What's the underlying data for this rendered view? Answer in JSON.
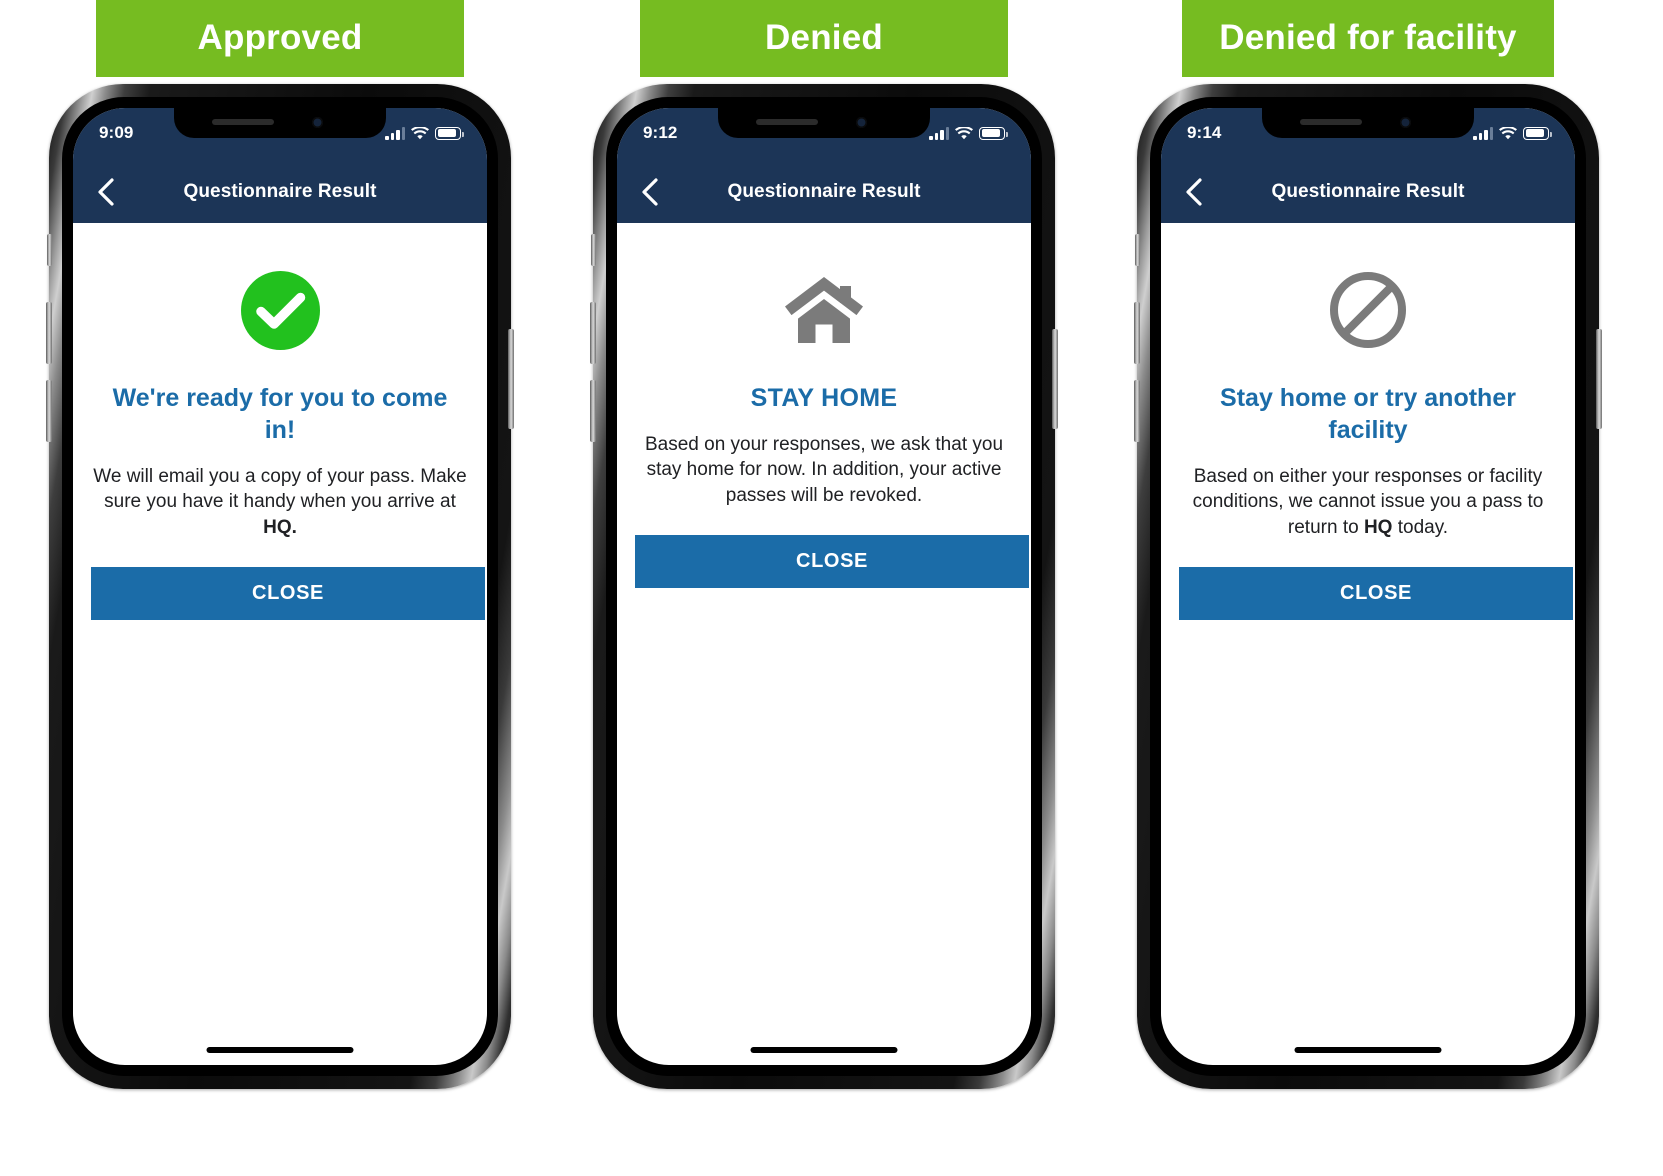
{
  "colors": {
    "banner_green": "#76bc21",
    "navbar_navy": "#1c3557",
    "accent_blue": "#1b6ca8",
    "success_green": "#22c11e",
    "icon_gray": "#7b7b7b"
  },
  "panels": [
    {
      "banner_label": "Approved",
      "status": {
        "time": "9:09",
        "signal_icon": "cellular-signal-icon",
        "wifi_icon": "wifi-icon",
        "battery_icon": "battery-icon"
      },
      "nav": {
        "back_icon": "back-chevron-icon",
        "title": "Questionnaire Result"
      },
      "result_icon": "green-check-circle-icon",
      "title": "We're ready for you to come in!",
      "body_lead": "We will email you a copy of your pass. Make sure you have it handy when you arrive at ",
      "body_bold": "HQ.",
      "body_tail": "",
      "close_label": "CLOSE"
    },
    {
      "banner_label": "Denied",
      "status": {
        "time": "9:12",
        "signal_icon": "cellular-signal-icon",
        "wifi_icon": "wifi-icon",
        "battery_icon": "battery-icon"
      },
      "nav": {
        "back_icon": "back-chevron-icon",
        "title": "Questionnaire Result"
      },
      "result_icon": "house-icon",
      "title": "STAY HOME",
      "body_lead": "Based on your responses, we ask that you stay home for now. In addition, your active passes will be revoked.",
      "body_bold": "",
      "body_tail": "",
      "close_label": "CLOSE"
    },
    {
      "banner_label": "Denied for facility",
      "status": {
        "time": "9:14",
        "signal_icon": "cellular-signal-icon",
        "wifi_icon": "wifi-icon",
        "battery_icon": "battery-icon"
      },
      "nav": {
        "back_icon": "back-chevron-icon",
        "title": "Questionnaire Result"
      },
      "result_icon": "no-entry-circle-slash-icon",
      "title": "Stay home or try another facility",
      "body_lead": "Based on either your responses or facility conditions, we cannot issue you a pass to return to ",
      "body_bold": "HQ",
      "body_tail": " today.",
      "close_label": "CLOSE"
    }
  ]
}
